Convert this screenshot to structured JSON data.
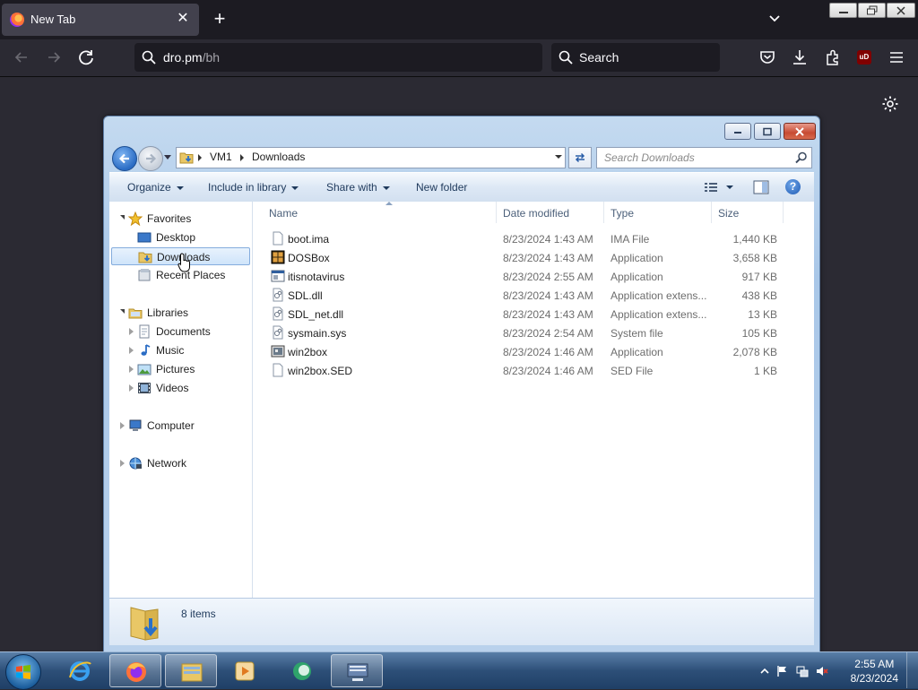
{
  "browser": {
    "tab_title": "New Tab",
    "url_host": "dro.pm",
    "url_path": "/bh",
    "search_label": "Search",
    "ublock_badge": "uD"
  },
  "explorer": {
    "breadcrumb": [
      "VM1",
      "Downloads"
    ],
    "search_placeholder": "Search Downloads",
    "commands": {
      "organize": "Organize",
      "include_in_library": "Include in library",
      "share_with": "Share with",
      "new_folder": "New folder"
    },
    "help_glyph": "?",
    "nav": {
      "favorites": "Favorites",
      "desktop": "Desktop",
      "downloads": "Downloads",
      "recent_places": "Recent Places",
      "libraries": "Libraries",
      "documents": "Documents",
      "music": "Music",
      "pictures": "Pictures",
      "videos": "Videos",
      "computer": "Computer",
      "network": "Network"
    },
    "columns": {
      "name": "Name",
      "date": "Date modified",
      "type": "Type",
      "size": "Size"
    },
    "files": [
      {
        "name": "boot.ima",
        "date": "8/23/2024 1:43 AM",
        "type": "IMA File",
        "size": "1,440 KB",
        "icon": "blank-file-icon"
      },
      {
        "name": "DOSBox",
        "date": "8/23/2024 1:43 AM",
        "type": "Application",
        "size": "3,658 KB",
        "icon": "dosbox-icon"
      },
      {
        "name": "itisnotavirus",
        "date": "8/23/2024 2:55 AM",
        "type": "Application",
        "size": "917 KB",
        "icon": "exe-icon"
      },
      {
        "name": "SDL.dll",
        "date": "8/23/2024 1:43 AM",
        "type": "Application extens...",
        "size": "438 KB",
        "icon": "dll-icon"
      },
      {
        "name": "SDL_net.dll",
        "date": "8/23/2024 1:43 AM",
        "type": "Application extens...",
        "size": "13 KB",
        "icon": "dll-icon"
      },
      {
        "name": "sysmain.sys",
        "date": "8/23/2024 2:54 AM",
        "type": "System file",
        "size": "105 KB",
        "icon": "sys-icon"
      },
      {
        "name": "win2box",
        "date": "8/23/2024 1:46 AM",
        "type": "Application",
        "size": "2,078 KB",
        "icon": "win2box-icon"
      },
      {
        "name": "win2box.SED",
        "date": "8/23/2024 1:46 AM",
        "type": "SED File",
        "size": "1 KB",
        "icon": "blank-file-icon"
      }
    ],
    "item_count": "8 items"
  },
  "taskbar": {
    "time": "2:55 AM",
    "date": "8/23/2024"
  },
  "colors": {
    "firefox_dark": "#2b2a33",
    "aero_blue": "#b9d1ec",
    "selection": "#cfe4fa",
    "taskbar": "#2d4f78"
  }
}
